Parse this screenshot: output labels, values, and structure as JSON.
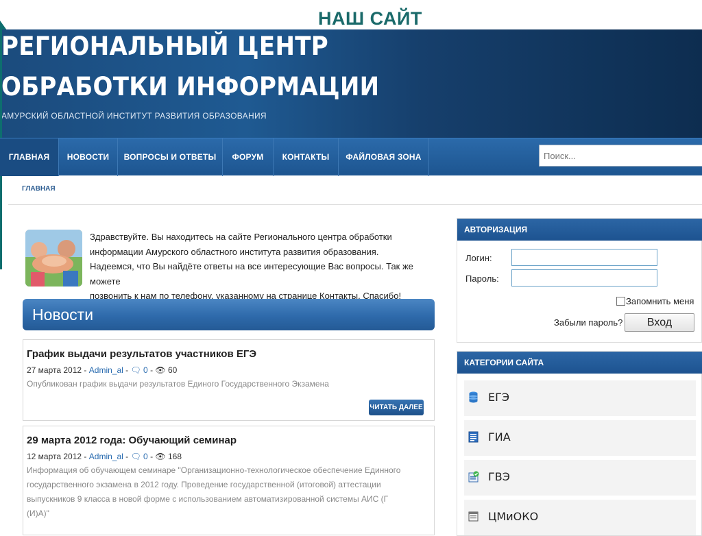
{
  "slide": {
    "title": "НАШ САЙТ"
  },
  "header": {
    "line1": "РЕГИОНАЛЬНЫЙ ЦЕНТР",
    "line2": "ОБРАБОТКИ ИНФОРМАЦИИ",
    "subtitle": "АМУРСКИЙ ОБЛАСТНОЙ ИНСТИТУТ РАЗВИТИЯ ОБРАЗОВАНИЯ"
  },
  "nav": {
    "items": [
      "ГЛАВНАЯ",
      "НОВОСТИ",
      "ВОПРОСЫ И ОТВЕТЫ",
      "ФОРУМ",
      "КОНТАКТЫ",
      "ФАЙЛОВАЯ ЗОНА"
    ]
  },
  "search": {
    "placeholder": "Поиск..."
  },
  "breadcrumb": "ГЛАВНАЯ",
  "welcome": {
    "line1": "Здравствуйте.  Вы находитесь на сайте Регионального центра обработки",
    "line2": "информации Амурского областного института развития образования.",
    "line3": "Надеемся, что Вы найдёте ответы на все интересующие Вас вопросы. Так же можете",
    "line4": "позвонить к нам по телефону, указанному на странице Контакты. Спасибо!"
  },
  "news": {
    "header": "Новости",
    "items": [
      {
        "title": "График выдачи результатов участников ЕГЭ",
        "date": "27 марта 2012",
        "author": "Admin_al",
        "comments": "0",
        "views": "60",
        "body": "Опубликован график выдачи результатов Единого Государственного Экзамена",
        "more": "ЧИТАТЬ ДАЛЕЕ"
      },
      {
        "title": "29 марта 2012 года: Обучающий семинар",
        "date": "12 марта 2012",
        "author": "Admin_al",
        "comments": "0",
        "views": "168",
        "body1": "Информация об обучающем семинаре \"Организационно-технологическое обеспечение Единного",
        "body2": "государственного экзамена в 2012 году. Проведение государственной (итоговой) аттестации",
        "body3": "выпускников 9 класса в новой форме с использованием автоматизированной системы АИС (Г",
        "body4": "(И)А)\""
      }
    ]
  },
  "auth": {
    "header": "АВТОРИЗАЦИЯ",
    "login_label": "Логин:",
    "password_label": "Пароль:",
    "remember": "Запомнить меня",
    "forgot": "Забыли пароль?",
    "button": "Вход"
  },
  "categories": {
    "header": "КАТЕГОРИИ САЙТА",
    "items": [
      {
        "label": "ЕГЭ",
        "icon": "database-icon"
      },
      {
        "label": "ГИА",
        "icon": "document-list-icon"
      },
      {
        "label": "ГВЭ",
        "icon": "checklist-icon"
      },
      {
        "label": "ЦМиОКО",
        "icon": "window-icon"
      }
    ]
  }
}
